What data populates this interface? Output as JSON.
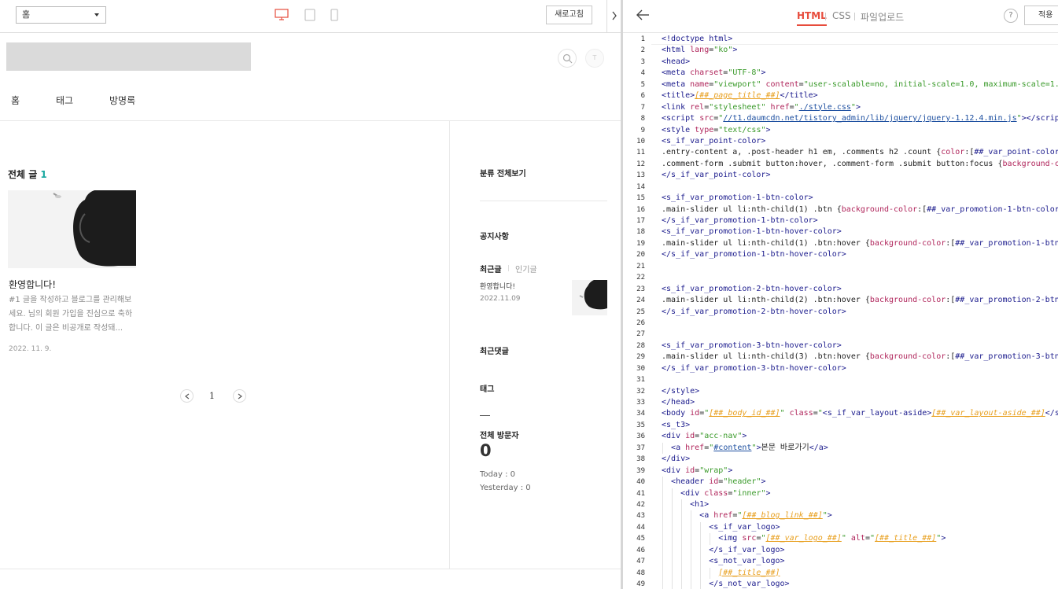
{
  "preview": {
    "page_select": "홈",
    "refresh_label": "새로고침",
    "nav": {
      "home": "홈",
      "tag": "태그",
      "guestbook": "방명록"
    },
    "content": {
      "all_posts_label": "전체 글",
      "all_posts_count": "1",
      "post": {
        "title": "환영합니다!",
        "excerpt": "#1 글을 작성하고 블로그를 관리해보세요. 님의 회원 가입을 진심으로 축하합니다. 이 글은 비공개로 작성돼...",
        "date": "2022. 11. 9."
      },
      "pagination": {
        "current": "1"
      }
    },
    "sidebar": {
      "category": "분류 전체보기",
      "notice": "공지사항",
      "tab_recent": "최근글",
      "tab_popular": "인기글",
      "recent_post_title": "환영합니다!",
      "recent_post_date": "2022.11.09",
      "recent_comments": "최근댓글",
      "tags": "태그",
      "visitors_label": "전체 방문자",
      "visitors_total": "0",
      "today": "Today : 0",
      "yesterday": "Yesterday : 0"
    }
  },
  "editor": {
    "tabs": {
      "html": "HTML",
      "css": "CSS",
      "file_upload": "파일업로드"
    },
    "help": "?",
    "apply_label": "적용",
    "active_tab_color": "#e74c3c"
  }
}
